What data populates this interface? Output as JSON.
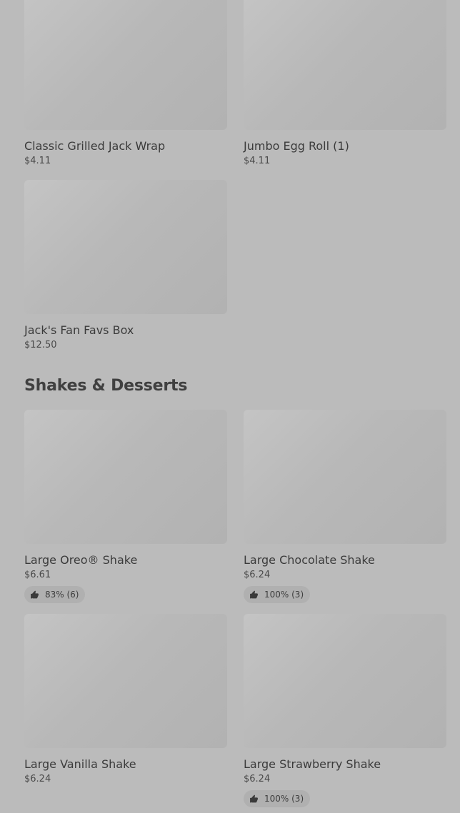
{
  "items_top": [
    {
      "name": "Classic Grilled Jack Wrap",
      "price": "$4.11"
    },
    {
      "name": "Jumbo Egg Roll (1)",
      "price": "$4.11"
    },
    {
      "name": "Jack's Fan Favs Box",
      "price": "$12.50"
    }
  ],
  "section": {
    "title": "Shakes & Desserts"
  },
  "shakes": [
    {
      "name": "Large Oreo® Shake",
      "price": "$6.61",
      "rating": "83% (6)"
    },
    {
      "name": "Large Chocolate Shake",
      "price": "$6.24",
      "rating": "100% (3)"
    },
    {
      "name": "Large Vanilla Shake",
      "price": "$6.24"
    },
    {
      "name": "Large Strawberry Shake",
      "price": "$6.24",
      "rating": "100% (3)"
    }
  ],
  "icons": {
    "rating": "thumbs-up-icon"
  },
  "colors": {
    "background": "#bbbbbb",
    "text": "#3a3a3a",
    "rating_pill": "#b0b0b0"
  }
}
